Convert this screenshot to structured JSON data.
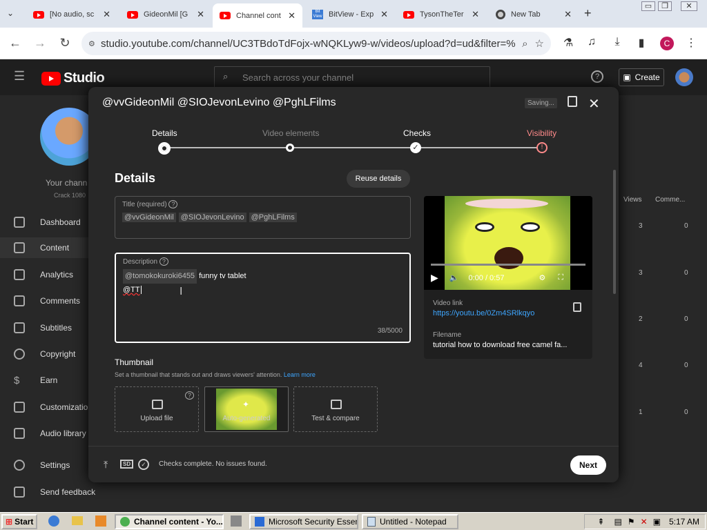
{
  "browser": {
    "tabs": [
      {
        "title": "[No audio, sc",
        "icon": "youtube-icon"
      },
      {
        "title": "GideonMil [G",
        "icon": "youtube-icon"
      },
      {
        "title": "Channel cont",
        "icon": "youtube-icon"
      },
      {
        "title": "BitView - Exp",
        "icon": "bitview-icon"
      },
      {
        "title": "TysonTheTer",
        "icon": "youtube-icon"
      },
      {
        "title": "New Tab",
        "icon": "chrome-icon"
      }
    ],
    "url": "studio.youtube.com/channel/UC3TBdoTdFojx-wNQKLyw9-w/videos/upload?d=ud&filter=%5B%...",
    "profile_initial": "C"
  },
  "studio": {
    "logo_text": "Studio",
    "search_placeholder": "Search across your channel",
    "create_label": "Create",
    "channel_label": "Your chann",
    "channel_sub": "Crack 1080",
    "sidebar": [
      "Dashboard",
      "Content",
      "Analytics",
      "Comments",
      "Subtitles",
      "Copyright",
      "Earn",
      "Customizatio",
      "Audio library",
      "Settings",
      "Send feedback"
    ],
    "table_headers": [
      "Views",
      "Comme..."
    ],
    "table_rows": [
      [
        "3",
        "0"
      ],
      [
        "3",
        "0"
      ],
      [
        "2",
        "0"
      ],
      [
        "4",
        "0"
      ],
      [
        "1",
        "0"
      ]
    ]
  },
  "modal": {
    "title": "@vvGideonMil @SIOJevonLevino @PghLFilms",
    "saving": "Saving...",
    "steps": [
      "Details",
      "Video elements",
      "Checks",
      "Visibility"
    ],
    "section_title": "Details",
    "reuse_label": "Reuse details",
    "title_field": {
      "label": "Title (required)",
      "chips": [
        "@vvGideonMil",
        "@SIOJevonLevino",
        "@PghLFilms"
      ]
    },
    "description_field": {
      "label": "Description",
      "chip": "@tomokokuroki6455",
      "text1": " funny tv tablet",
      "text2": "@TT",
      "counter": "38/5000"
    },
    "thumbnail": {
      "title": "Thumbnail",
      "desc": "Set a thumbnail that stands out and draws viewers' attention.",
      "learn_more": "Learn more",
      "options": [
        "Upload file",
        "Auto-generated",
        "Test & compare"
      ]
    },
    "video": {
      "time": "0:00 / 0:57",
      "link_label": "Video link",
      "link": "https://youtu.be/0Zm4SRlkqyo",
      "filename_label": "Filename",
      "filename": "tutorial how to download free camel fa..."
    },
    "footer_status": "Checks complete. No issues found.",
    "footer_sd": "SD",
    "next_label": "Next"
  },
  "taskbar": {
    "start": "Start",
    "items": [
      "Channel content - Yo...",
      "Microsoft Security Essen...",
      "Untitled - Notepad"
    ],
    "clock": "5:17 AM"
  }
}
